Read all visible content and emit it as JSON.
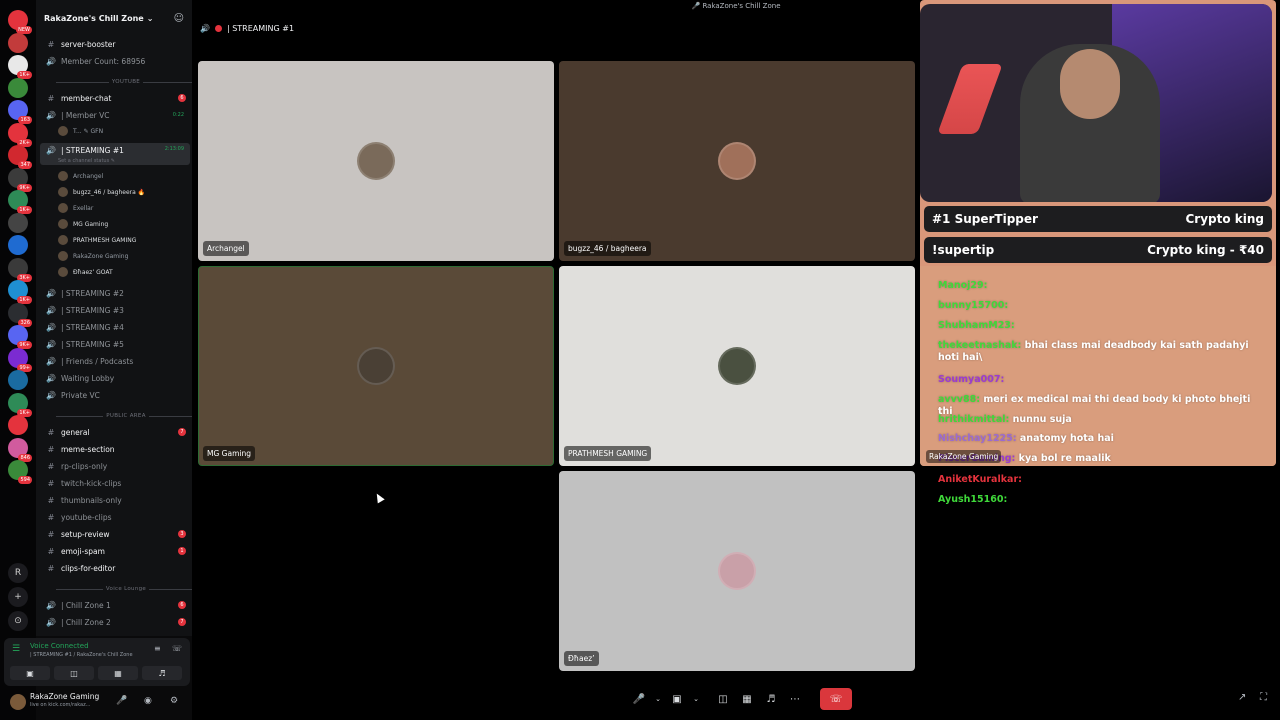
{
  "window_title": "RakaZone's Chill Zone",
  "server_rail": [
    {
      "name": "new",
      "badge": "NEW",
      "color": "#e4333d"
    },
    {
      "name": "server-a",
      "badge": "",
      "color": "#c23b3b"
    },
    {
      "name": "server-b",
      "badge": "1K+",
      "color": "#e8e8e8"
    },
    {
      "name": "server-c",
      "badge": "",
      "color": "#3a8a3a"
    },
    {
      "name": "server-d",
      "badge": "163",
      "color": "#5865f2"
    },
    {
      "name": "server-e",
      "badge": "2K+",
      "color": "#e4333d"
    },
    {
      "name": "server-f",
      "badge": "347",
      "color": "#d1282f"
    },
    {
      "name": "server-g",
      "badge": "9K+",
      "color": "#3b3b3b"
    },
    {
      "name": "server-h",
      "badge": "1K+",
      "color": "#2e8b57"
    },
    {
      "name": "server-i",
      "badge": "",
      "color": "#444"
    },
    {
      "name": "server-j",
      "badge": "",
      "color": "#1f6bd1"
    },
    {
      "name": "server-k",
      "badge": "3K+",
      "color": "#3a3a3a"
    },
    {
      "name": "server-l",
      "badge": "1K+",
      "color": "#1f8fd1"
    },
    {
      "name": "server-m",
      "badge": "326",
      "color": "#2b2d31"
    },
    {
      "name": "server-n",
      "badge": "9K+",
      "color": "#5865f2"
    },
    {
      "name": "server-o",
      "badge": "99+",
      "color": "#7b2bd1"
    },
    {
      "name": "server-p",
      "badge": "",
      "color": "#1a6ba0"
    },
    {
      "name": "server-q",
      "badge": "1K+",
      "color": "#2e8b57"
    },
    {
      "name": "server-r",
      "badge": "",
      "color": "#e4333d"
    },
    {
      "name": "server-s",
      "badge": "846",
      "color": "#d15b9e"
    },
    {
      "name": "server-t",
      "badge": "594",
      "color": "#3a8a3a"
    }
  ],
  "server_text_buttons": [
    "R",
    "+",
    "⊙"
  ],
  "guild": {
    "name": "RakaZone's Chill Zone"
  },
  "channels_top": [
    {
      "label": "server-booster",
      "type": "text",
      "bright": true
    },
    {
      "label": "Member Count: 68956",
      "type": "voice",
      "bright": false
    }
  ],
  "category_youtube": "YOUTUBE",
  "channels_youtube": [
    {
      "label": "member-chat",
      "type": "text",
      "bright": true,
      "badge": "6"
    },
    {
      "label": "| Member VC",
      "type": "voice",
      "bright": false,
      "time": "0:22"
    }
  ],
  "member_vc_user": "T... ✎ GFN",
  "streaming1": {
    "label": "| STREAMING #1",
    "time": "2:13:09",
    "status": "Set a channel status ✎"
  },
  "streaming1_users": [
    {
      "name": "Archangel",
      "bright": false
    },
    {
      "name": "bugzz_46 / bagheera 🔥",
      "bright": true
    },
    {
      "name": "Exellar",
      "bright": false
    },
    {
      "name": "MG Gaming",
      "bright": true
    },
    {
      "name": "PRATHMESH GAMING",
      "bright": true
    },
    {
      "name": "RakaZone Gaming",
      "bright": false
    },
    {
      "name": "Đħaez’ GOAT",
      "bright": true
    }
  ],
  "streaming_channels": [
    "| STREAMING #2",
    "| STREAMING #3",
    "| STREAMING #4",
    "| STREAMING #5",
    "| Friends / Podcasts",
    "Waiting Lobby",
    "Private VC"
  ],
  "category_public": "PUBLIC AREA",
  "public_channels": [
    {
      "label": "general",
      "bright": true,
      "badge": "7"
    },
    {
      "label": "meme-section",
      "bright": true,
      "badge": ""
    },
    {
      "label": "rp-clips-only",
      "bright": false,
      "badge": ""
    },
    {
      "label": "twitch-kick-clips",
      "bright": false,
      "badge": ""
    },
    {
      "label": "thumbnails-only",
      "bright": false,
      "badge": ""
    },
    {
      "label": "youtube-clips",
      "bright": false,
      "badge": ""
    },
    {
      "label": "setup-review",
      "bright": true,
      "badge": "3"
    },
    {
      "label": "emoji-spam",
      "bright": true,
      "badge": "1"
    },
    {
      "label": "clips-for-editor",
      "bright": true,
      "badge": ""
    }
  ],
  "category_voice": "Voice Lounge",
  "voice_lounge": [
    {
      "label": "| Chill Zone 1",
      "badge": "6"
    },
    {
      "label": "| Chill Zone 2",
      "badge": "7"
    }
  ],
  "voice_panel": {
    "title": "Voice Connected",
    "sub": "| STREAMING #1 / RakaZone's Chill Zone"
  },
  "user_panel": {
    "name": "RakaZone Gaming",
    "status": "live on kick.com/rakaz..."
  },
  "call": {
    "channel": "| STREAMING #1"
  },
  "tiles": [
    {
      "label": "Archangel",
      "bg": "#c8c4c1",
      "speaking": false,
      "avatar": "#7a6a5a"
    },
    {
      "label": "bugzz_46 / bagheera",
      "bg": "#4a3a2e",
      "speaking": false,
      "avatar": "#a0705a"
    },
    {
      "label": "MG Gaming",
      "bg": "#5a4a38",
      "speaking": true,
      "avatar": "#4a4035"
    },
    {
      "label": "PRATHMESH GAMING",
      "bg": "#e0dfdc",
      "speaking": false,
      "avatar": "#4a5040"
    },
    {
      "label": "Đħaez’",
      "bg": "#c1c1c1",
      "speaking": false,
      "avatar": "#c9a0a8"
    }
  ],
  "stream_overlay": {
    "top_left": "#1 SuperTipper",
    "top_right": "Crypto king",
    "bottom_left": "!supertip",
    "bottom_right": "Crypto king - ₹40",
    "label": "RakaZone Gaming"
  },
  "chat_messages": [
    {
      "name": "Manoj29:",
      "text": "",
      "color": "#3fd93a"
    },
    {
      "name": "bunny15700:",
      "text": "",
      "color": "#3fd93a"
    },
    {
      "name": "ShubhamM23:",
      "text": "",
      "color": "#3fd93a"
    },
    {
      "name": "thekeetnashak:",
      "text": "bhai class mai deadbody kai sath padahyi hoti hai\\",
      "color": "#3fd93a"
    },
    {
      "name": "Soumya007:",
      "text": "",
      "color": "#9b3bd1"
    },
    {
      "name": "avvv88:",
      "text": "meri ex medical mai thi dead body ki photo bhejti thi",
      "color": "#3fd93a"
    },
    {
      "name": "hrithikmittal:",
      "text": "nunnu suja",
      "color": "#3fd93a"
    },
    {
      "name": "Nishchay1225:",
      "text": "anatomy hota hai",
      "color": "#9b6bd1"
    },
    {
      "name": "PiscerGaming:",
      "text": "kya bol re maalik",
      "color": "#9b3bd1"
    }
  ],
  "chat_below": [
    {
      "name": "AniketKuralkar:",
      "color": "#e4333d"
    },
    {
      "name": "Ayush15160:",
      "color": "#3fd93a"
    }
  ]
}
